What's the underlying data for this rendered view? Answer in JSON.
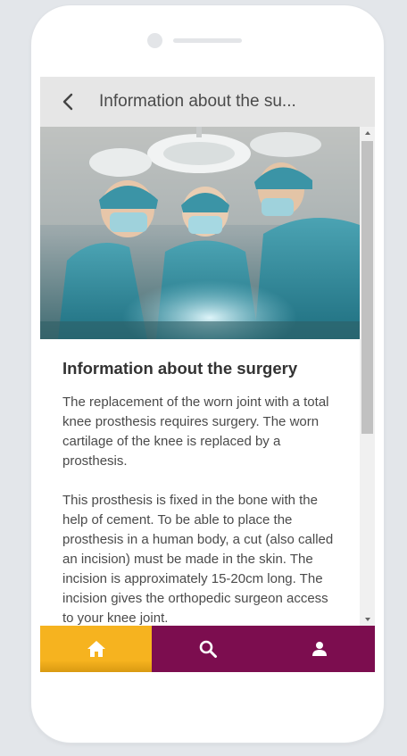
{
  "header": {
    "title": "Information about the su..."
  },
  "article": {
    "title": "Information about the surgery",
    "paragraphs": [
      "The replacement of the worn joint with a total knee prosthesis requires surgery. The worn cartilage of the knee is replaced by a prosthesis.",
      "This prosthesis is fixed in the bone with the help of cement. To be able to place the prosthesis in a human body, a cut (also called an incision) must be made in the skin. The incision is approximately 15-20cm long. The incision gives the orthopedic surgeon access to your knee joint."
    ]
  },
  "tabbar": {
    "items": [
      {
        "icon": "home-icon",
        "active": true
      },
      {
        "icon": "search-icon",
        "active": false
      },
      {
        "icon": "user-icon",
        "active": false
      }
    ]
  },
  "colors": {
    "header_bg": "#e6e6e6",
    "tab_active": "#f6b31f",
    "tab_inactive": "#7c0d4f"
  }
}
